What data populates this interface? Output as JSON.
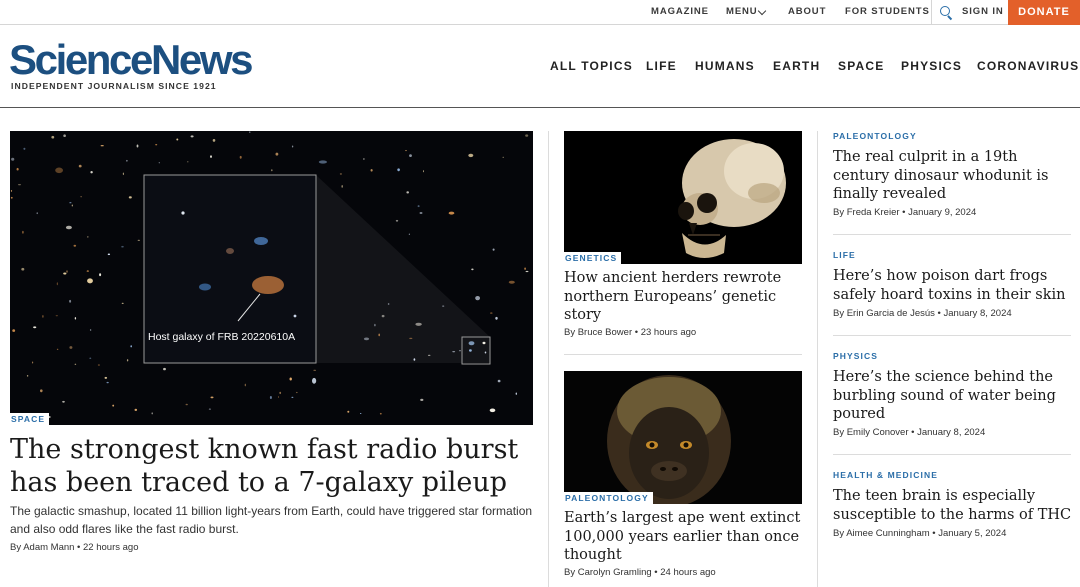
{
  "utility_nav": {
    "magazine": "MAGAZINE",
    "menu": "MENU",
    "about": "ABOUT",
    "for_students": "FOR STUDENTS",
    "sign_in": "SIGN IN",
    "donate": "DONATE"
  },
  "brand": {
    "logo": "ScienceNews",
    "tagline": "INDEPENDENT JOURNALISM SINCE 1921",
    "color": "#1c4f80",
    "accent": "#2b6ea8",
    "donate_color": "#e3602a"
  },
  "main_nav": [
    "ALL TOPICS",
    "LIFE",
    "HUMANS",
    "EARTH",
    "SPACE",
    "PHYSICS",
    "CORONAVIRUS"
  ],
  "lead": {
    "tag": "SPACE",
    "image_caption": "Host galaxy of FRB 20220610A",
    "headline": "The strongest known fast radio burst has been traced to a 7-galaxy pileup",
    "dek": "The galactic smashup, located 11 billion light-years from Earth, could have triggered star formation and also odd flares like the fast radio burst.",
    "byline": "By Adam Mann • 22 hours ago"
  },
  "middle": [
    {
      "tag": "GENETICS",
      "headline": "How ancient herders rewrote northern Europeans’ genetic story",
      "byline": "By Bruce Bower • 23 hours ago"
    },
    {
      "tag": "PALEONTOLOGY",
      "headline": "Earth’s largest ape went extinct 100,000 years earlier than once thought",
      "byline": "By Carolyn Gramling • 24 hours ago"
    }
  ],
  "right": [
    {
      "tag": "PALEONTOLOGY",
      "headline": "The real culprit in a 19th century dinosaur whodunit is finally revealed",
      "byline": "By Freda Kreier • January 9, 2024"
    },
    {
      "tag": "LIFE",
      "headline": "Here’s how poison dart frogs safely hoard toxins in their skin",
      "byline": "By Erin Garcia de Jesús • January 8, 2024"
    },
    {
      "tag": "PHYSICS",
      "headline": "Here’s the science behind the burbling sound of water being poured",
      "byline": "By Emily Conover • January 8, 2024"
    },
    {
      "tag": "HEALTH & MEDICINE",
      "headline": "The teen brain is especially susceptible to the harms of THC",
      "byline": "By Aimee Cunningham • January 5, 2024"
    }
  ],
  "icons": [
    "search-icon",
    "chevron-down-icon"
  ]
}
